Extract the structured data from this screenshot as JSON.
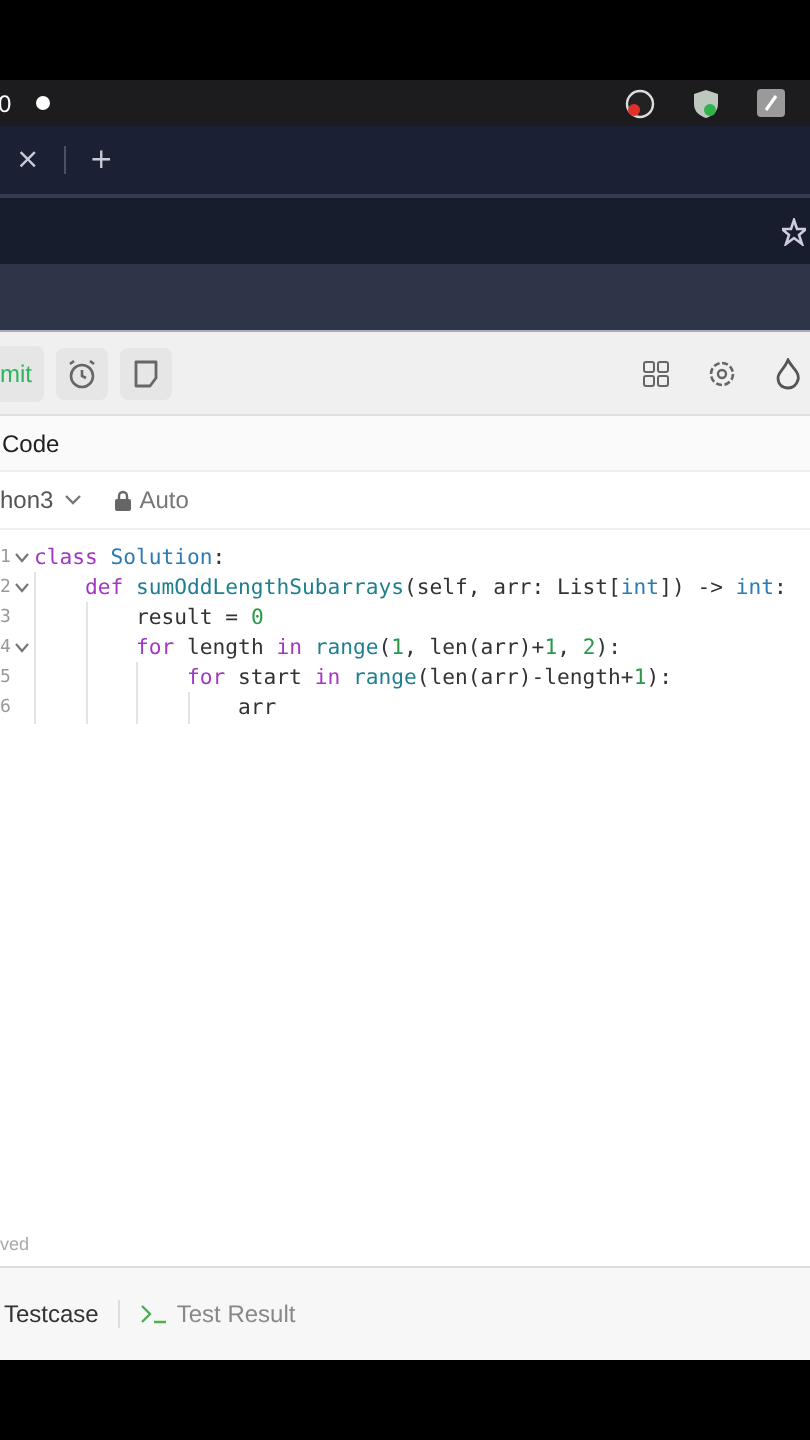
{
  "status_bar": {
    "clock": "0"
  },
  "browser_tabs": {
    "close": "×",
    "new_tab": "+"
  },
  "toolbar": {
    "submit": "mit"
  },
  "editor": {
    "title": "Code",
    "language": "hon3",
    "mode": "Auto",
    "lines": [
      {
        "number": "1",
        "foldable": true,
        "tokens": [
          {
            "kind": "keyword",
            "text": "class"
          },
          {
            "kind": "type",
            "text": " Solution"
          },
          {
            "kind": "plain",
            "text": ":"
          }
        ]
      },
      {
        "number": "2",
        "foldable": true,
        "tokens": [
          {
            "kind": "keyword",
            "text": "    def"
          },
          {
            "kind": "function",
            "text": " sumOddLengthSubarrays"
          },
          {
            "kind": "plain",
            "text": "(self, arr: List["
          },
          {
            "kind": "type",
            "text": "int"
          },
          {
            "kind": "plain",
            "text": "]) -> "
          },
          {
            "kind": "type",
            "text": "int"
          },
          {
            "kind": "plain",
            "text": ":"
          }
        ]
      },
      {
        "number": "3",
        "foldable": false,
        "tokens": [
          {
            "kind": "plain",
            "text": "        result = "
          },
          {
            "kind": "number",
            "text": "0"
          }
        ]
      },
      {
        "number": "4",
        "foldable": true,
        "tokens": [
          {
            "kind": "keyword",
            "text": "        for"
          },
          {
            "kind": "plain",
            "text": " length "
          },
          {
            "kind": "keyword",
            "text": "in"
          },
          {
            "kind": "function",
            "text": " range"
          },
          {
            "kind": "plain",
            "text": "("
          },
          {
            "kind": "number",
            "text": "1"
          },
          {
            "kind": "plain",
            "text": ", len(arr)+"
          },
          {
            "kind": "number",
            "text": "1"
          },
          {
            "kind": "plain",
            "text": ", "
          },
          {
            "kind": "number",
            "text": "2"
          },
          {
            "kind": "plain",
            "text": "):"
          }
        ]
      },
      {
        "number": "5",
        "foldable": false,
        "tokens": [
          {
            "kind": "keyword",
            "text": "            for"
          },
          {
            "kind": "plain",
            "text": " start "
          },
          {
            "kind": "keyword",
            "text": "in"
          },
          {
            "kind": "function",
            "text": " range"
          },
          {
            "kind": "plain",
            "text": "(len(arr)-length+"
          },
          {
            "kind": "number",
            "text": "1"
          },
          {
            "kind": "plain",
            "text": "):"
          }
        ]
      },
      {
        "number": "6",
        "foldable": false,
        "tokens": [
          {
            "kind": "plain",
            "text": "                arr"
          }
        ]
      }
    ],
    "save_state": "ved"
  },
  "bottom_tabs": [
    {
      "label": "Testcase",
      "selected": true
    },
    {
      "label": "Test Result",
      "selected": false
    }
  ]
}
